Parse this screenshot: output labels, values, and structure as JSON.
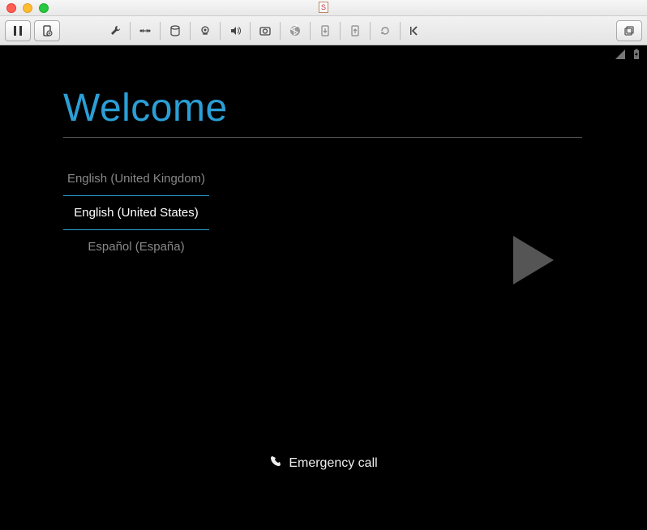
{
  "title_tab_glyph": "S",
  "welcome": {
    "title": "Welcome"
  },
  "languages": [
    {
      "label": "English (United Kingdom)",
      "selected": false
    },
    {
      "label": "English (United States)",
      "selected": true
    },
    {
      "label": "Español (España)",
      "selected": false
    }
  ],
  "emergency_label": "Emergency call"
}
